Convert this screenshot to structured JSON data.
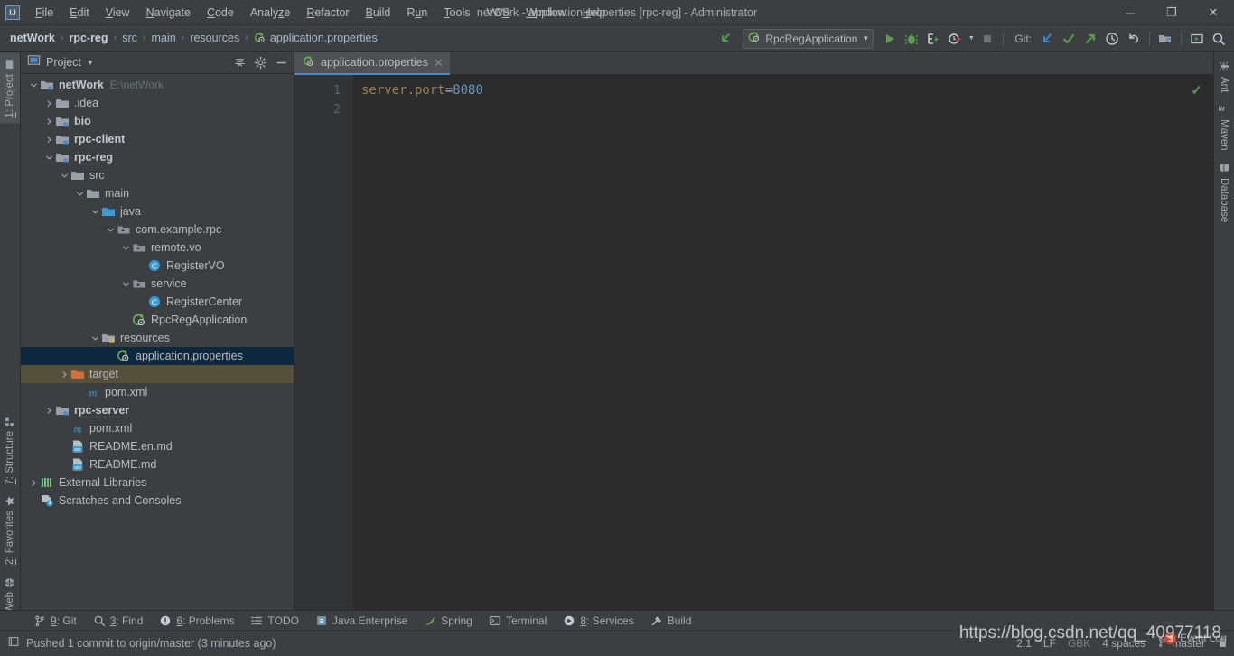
{
  "window": {
    "title": "netWork - application.properties [rpc-reg] - Administrator",
    "logo_text": "IJ",
    "minimize": "─",
    "maximize": "❐",
    "close": "✕"
  },
  "menu": {
    "items": [
      {
        "label": "File",
        "mnemonic": "F"
      },
      {
        "label": "Edit",
        "mnemonic": "E"
      },
      {
        "label": "View",
        "mnemonic": "V"
      },
      {
        "label": "Navigate",
        "mnemonic": "N"
      },
      {
        "label": "Code",
        "mnemonic": "C"
      },
      {
        "label": "Analyze",
        "mnemonic": "z"
      },
      {
        "label": "Refactor",
        "mnemonic": "R"
      },
      {
        "label": "Build",
        "mnemonic": "B"
      },
      {
        "label": "Run",
        "mnemonic": "u"
      },
      {
        "label": "Tools",
        "mnemonic": "T"
      },
      {
        "label": "VCS",
        "mnemonic": "S"
      },
      {
        "label": "Window",
        "mnemonic": "W"
      },
      {
        "label": "Help",
        "mnemonic": "H"
      }
    ]
  },
  "breadcrumb": {
    "separator": "›",
    "items": [
      {
        "label": "netWork",
        "bold": true,
        "icon": null
      },
      {
        "label": "rpc-reg",
        "bold": true,
        "icon": null
      },
      {
        "label": "src",
        "bold": false,
        "icon": null
      },
      {
        "label": "main",
        "bold": false,
        "icon": null
      },
      {
        "label": "resources",
        "bold": false,
        "icon": null
      },
      {
        "label": "application.properties",
        "bold": false,
        "icon": "properties-file-icon"
      }
    ]
  },
  "toolbar": {
    "back_icon": "back-arrow-icon",
    "run_config": "RpcRegApplication",
    "run_config_icon": "spring-boot-icon",
    "dropdown_caret": "▼",
    "run_icon": "run-icon",
    "debug_icon": "debug-icon",
    "run_coverage_icon": "run-with-coverage-icon",
    "profile_icon": "profiler-icon",
    "stop_icon": "stop-icon",
    "git_label": "Git:",
    "git_update_icon": "git-update-icon",
    "git_commit_icon": "git-commit-icon",
    "git_push_icon": "git-push-icon",
    "git_history_icon": "git-history-icon",
    "git_revert_icon": "git-revert-icon",
    "project_structure_icon": "project-structure-icon",
    "run_anything_icon": "run-anything-icon",
    "search_icon": "search-everywhere-icon"
  },
  "left_strip": {
    "top": [
      {
        "label": "1: Project",
        "mnemonic": "1",
        "icon": "project-icon",
        "active": true
      }
    ],
    "bottom": [
      {
        "label": "7: Structure",
        "mnemonic": "7",
        "icon": "structure-icon",
        "active": false
      },
      {
        "label": "2: Favorites",
        "mnemonic": "2",
        "icon": "favorites-star-icon",
        "active": false
      },
      {
        "label": "Web",
        "mnemonic": "",
        "icon": "web-globe-icon",
        "active": false
      }
    ]
  },
  "right_strip": {
    "items": [
      {
        "label": "Ant",
        "icon": "ant-icon"
      },
      {
        "label": "Maven",
        "icon": "maven-icon"
      },
      {
        "label": "Database",
        "icon": "database-icon"
      }
    ]
  },
  "project_panel": {
    "title": "Project",
    "view_icon": "project-view-icon",
    "dropdown_caret": "▼",
    "collapse_all_icon": "collapse-all-icon",
    "settings_icon": "gear-icon",
    "hide_icon": "hide-panel-icon",
    "tree": [
      {
        "label": "netWork",
        "sub": "E:\\netWork",
        "depth": 0,
        "arrow": "expanded",
        "icon": "module-folder-icon",
        "bold": true,
        "state": "normal"
      },
      {
        "label": ".idea",
        "sub": "",
        "depth": 1,
        "arrow": "collapsed",
        "icon": "folder-icon",
        "bold": false,
        "state": "normal"
      },
      {
        "label": "bio",
        "sub": "",
        "depth": 1,
        "arrow": "collapsed",
        "icon": "module-folder-icon",
        "bold": true,
        "state": "normal"
      },
      {
        "label": "rpc-client",
        "sub": "",
        "depth": 1,
        "arrow": "collapsed",
        "icon": "module-folder-icon",
        "bold": true,
        "state": "normal"
      },
      {
        "label": "rpc-reg",
        "sub": "",
        "depth": 1,
        "arrow": "expanded",
        "icon": "module-folder-icon",
        "bold": true,
        "state": "normal"
      },
      {
        "label": "src",
        "sub": "",
        "depth": 2,
        "arrow": "expanded",
        "icon": "folder-icon",
        "bold": false,
        "state": "normal"
      },
      {
        "label": "main",
        "sub": "",
        "depth": 3,
        "arrow": "expanded",
        "icon": "folder-icon",
        "bold": false,
        "state": "normal"
      },
      {
        "label": "java",
        "sub": "",
        "depth": 4,
        "arrow": "expanded",
        "icon": "source-folder-icon",
        "bold": false,
        "state": "normal"
      },
      {
        "label": "com.example.rpc",
        "sub": "",
        "depth": 5,
        "arrow": "expanded",
        "icon": "package-icon",
        "bold": false,
        "state": "normal"
      },
      {
        "label": "remote.vo",
        "sub": "",
        "depth": 6,
        "arrow": "expanded",
        "icon": "package-icon",
        "bold": false,
        "state": "normal"
      },
      {
        "label": "RegisterVO",
        "sub": "",
        "depth": 7,
        "arrow": "none",
        "icon": "class-icon",
        "bold": false,
        "state": "normal"
      },
      {
        "label": "service",
        "sub": "",
        "depth": 6,
        "arrow": "expanded",
        "icon": "package-icon",
        "bold": false,
        "state": "normal"
      },
      {
        "label": "RegisterCenter",
        "sub": "",
        "depth": 7,
        "arrow": "none",
        "icon": "class-icon",
        "bold": false,
        "state": "normal"
      },
      {
        "label": "RpcRegApplication",
        "sub": "",
        "depth": 6,
        "arrow": "none",
        "icon": "spring-boot-class-icon",
        "bold": false,
        "state": "normal"
      },
      {
        "label": "resources",
        "sub": "",
        "depth": 4,
        "arrow": "expanded",
        "icon": "resources-folder-icon",
        "bold": false,
        "state": "normal"
      },
      {
        "label": "application.properties",
        "sub": "",
        "depth": 5,
        "arrow": "none",
        "icon": "properties-file-icon",
        "bold": false,
        "state": "selected"
      },
      {
        "label": "target",
        "sub": "",
        "depth": 2,
        "arrow": "collapsed",
        "icon": "excluded-folder-icon",
        "bold": false,
        "state": "excluded"
      },
      {
        "label": "pom.xml",
        "sub": "",
        "depth": 3,
        "arrow": "none",
        "icon": "maven-file-icon",
        "bold": false,
        "state": "normal"
      },
      {
        "label": "rpc-server",
        "sub": "",
        "depth": 1,
        "arrow": "collapsed",
        "icon": "module-folder-icon",
        "bold": true,
        "state": "normal"
      },
      {
        "label": "pom.xml",
        "sub": "",
        "depth": 2,
        "arrow": "none",
        "icon": "maven-file-icon",
        "bold": false,
        "state": "normal"
      },
      {
        "label": "README.en.md",
        "sub": "",
        "depth": 2,
        "arrow": "none",
        "icon": "markdown-file-icon",
        "bold": false,
        "state": "normal"
      },
      {
        "label": "README.md",
        "sub": "",
        "depth": 2,
        "arrow": "none",
        "icon": "markdown-file-icon",
        "bold": false,
        "state": "normal"
      },
      {
        "label": "External Libraries",
        "sub": "",
        "depth": 0,
        "arrow": "collapsed",
        "icon": "libraries-icon",
        "bold": false,
        "state": "normal"
      },
      {
        "label": "Scratches and Consoles",
        "sub": "",
        "depth": 0,
        "arrow": "none",
        "icon": "scratches-icon",
        "bold": false,
        "state": "normal"
      }
    ]
  },
  "editor": {
    "tab": {
      "label": "application.properties",
      "icon": "properties-file-icon",
      "close": "✕"
    },
    "line_numbers": [
      "1",
      "2"
    ],
    "lines": [
      {
        "key": "server.port",
        "eq": "=",
        "value": "8080"
      },
      {
        "key": "",
        "eq": "",
        "value": ""
      }
    ],
    "inspection_mark": "✓",
    "inspection_icon": "inspection-ok-icon"
  },
  "bottom_bar": {
    "items": [
      {
        "label": "9: Git",
        "mnemonic": "9",
        "icon": "git-branch-icon"
      },
      {
        "label": "3: Find",
        "mnemonic": "3",
        "icon": "find-icon"
      },
      {
        "label": "6: Problems",
        "mnemonic": "6",
        "icon": "problems-icon"
      },
      {
        "label": "TODO",
        "mnemonic": "",
        "icon": "todo-icon"
      },
      {
        "label": "Java Enterprise",
        "mnemonic": "",
        "icon": "java-enterprise-icon"
      },
      {
        "label": "Spring",
        "mnemonic": "",
        "icon": "spring-leaf-icon"
      },
      {
        "label": "Terminal",
        "mnemonic": "",
        "icon": "terminal-icon"
      },
      {
        "label": "8: Services",
        "mnemonic": "8",
        "icon": "services-icon"
      },
      {
        "label": "Build",
        "mnemonic": "",
        "icon": "build-hammer-icon"
      }
    ]
  },
  "status_bar": {
    "message_icon": "message-icon",
    "message": "Pushed 1 commit to origin/master (3 minutes ago)",
    "caret_position": "2:1",
    "line_separator": "LF",
    "encoding": "GBK",
    "indent": "4 spaces",
    "branch": "master",
    "branch_icon": "git-branch-icon",
    "lock_icon": "lock-icon",
    "event_log_label": "Event Log",
    "event_log_count": "3"
  },
  "watermark": {
    "text": "https://blog.csdn.net/qq_40977118"
  },
  "colors": {
    "bg_panel": "#3c3f41",
    "bg_editor": "#2b2b2b",
    "bg_gutter": "#313335",
    "selection": "#0d293f",
    "excluded": "#55503c",
    "accent_blue": "#4a88c7",
    "text": "#bbbbbb",
    "key_orange": "#9a7f56",
    "value_blue": "#6897bb",
    "green": "#5a9c4c",
    "badge_red": "#cc4b3b"
  }
}
